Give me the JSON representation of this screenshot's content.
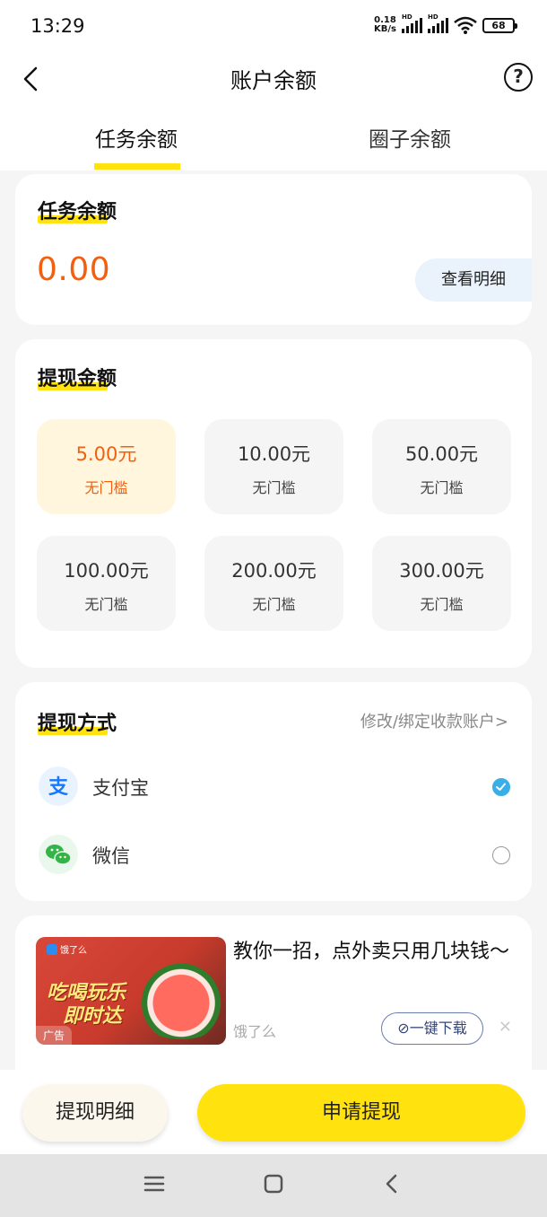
{
  "status_bar": {
    "time": "13:29",
    "net_speed_value": "0.18",
    "net_speed_unit": "KB/s",
    "signal1_label": "HD",
    "signal2_label": "HD",
    "battery": "68"
  },
  "header": {
    "title": "账户余额",
    "help_icon": "question-circle-icon",
    "back_icon": "chevron-left-icon"
  },
  "tabs": [
    {
      "label": "任务余额",
      "active": true
    },
    {
      "label": "圈子余额",
      "active": false
    }
  ],
  "balance": {
    "title": "任务余额",
    "amount": "0.00",
    "detail_label": "查看明细"
  },
  "withdraw_amounts": {
    "title": "提现金额",
    "options": [
      {
        "value": "5.00元",
        "sub": "无门槛",
        "selected": true
      },
      {
        "value": "10.00元",
        "sub": "无门槛",
        "selected": false
      },
      {
        "value": "50.00元",
        "sub": "无门槛",
        "selected": false
      },
      {
        "value": "100.00元",
        "sub": "无门槛",
        "selected": false
      },
      {
        "value": "200.00元",
        "sub": "无门槛",
        "selected": false
      },
      {
        "value": "300.00元",
        "sub": "无门槛",
        "selected": false
      }
    ]
  },
  "withdraw_method": {
    "title": "提现方式",
    "edit_label": "修改/绑定收款账户>",
    "methods": [
      {
        "label": "支付宝",
        "icon": "alipay-icon",
        "selected": true
      },
      {
        "label": "微信",
        "icon": "wechat-icon",
        "selected": false
      }
    ]
  },
  "ad": {
    "headline": "教你一招，点外卖只用几块钱～",
    "source": "饿了么",
    "download_label": "一键下载",
    "image_brand": "饿了么",
    "image_slogan1": "吃喝玩乐",
    "image_slogan2": "即时达",
    "ad_tag": "广告"
  },
  "bottom": {
    "detail_button": "提现明细",
    "apply_button": "申请提现"
  },
  "colors": {
    "accent_yellow": "#ffe20e",
    "amount_orange": "#f2600f",
    "radio_blue": "#3aaee6"
  }
}
